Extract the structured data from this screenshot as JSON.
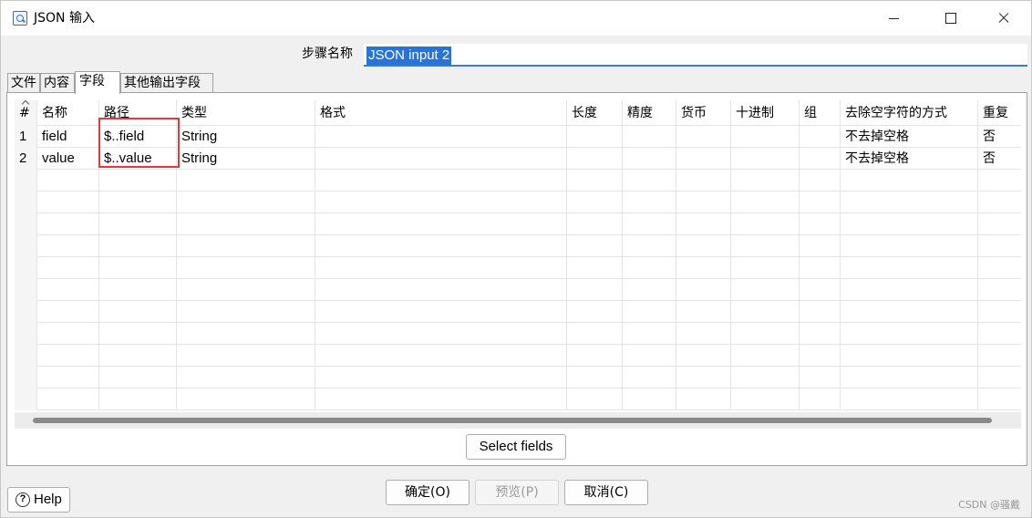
{
  "window": {
    "title": "JSON 输入"
  },
  "step": {
    "label": "步骤名称",
    "value": "JSON input 2"
  },
  "tabs": [
    {
      "label": "文件"
    },
    {
      "label": "内容"
    },
    {
      "label": "字段",
      "active": true
    },
    {
      "label": "其他输出字段"
    }
  ],
  "table": {
    "headers": [
      "#",
      "名称",
      "路径",
      "类型",
      "格式",
      "长度",
      "精度",
      "货币",
      "十进制",
      "组",
      "去除空字符的方式",
      "重复"
    ],
    "rows": [
      {
        "num": "1",
        "name": "field",
        "path": "$..field",
        "type": "String",
        "format": "",
        "length": "",
        "precision": "",
        "currency": "",
        "decimal": "",
        "group": "",
        "trim": "不去掉空格",
        "repeat": "否"
      },
      {
        "num": "2",
        "name": "value",
        "path": "$..value",
        "type": "String",
        "format": "",
        "length": "",
        "precision": "",
        "currency": "",
        "decimal": "",
        "group": "",
        "trim": "不去掉空格",
        "repeat": "否"
      }
    ]
  },
  "buttons": {
    "select_fields": "Select fields",
    "ok": "确定(O)",
    "preview": "预览(P)",
    "cancel": "取消(C)",
    "help": "Help"
  },
  "watermark": "CSDN @骚戴"
}
